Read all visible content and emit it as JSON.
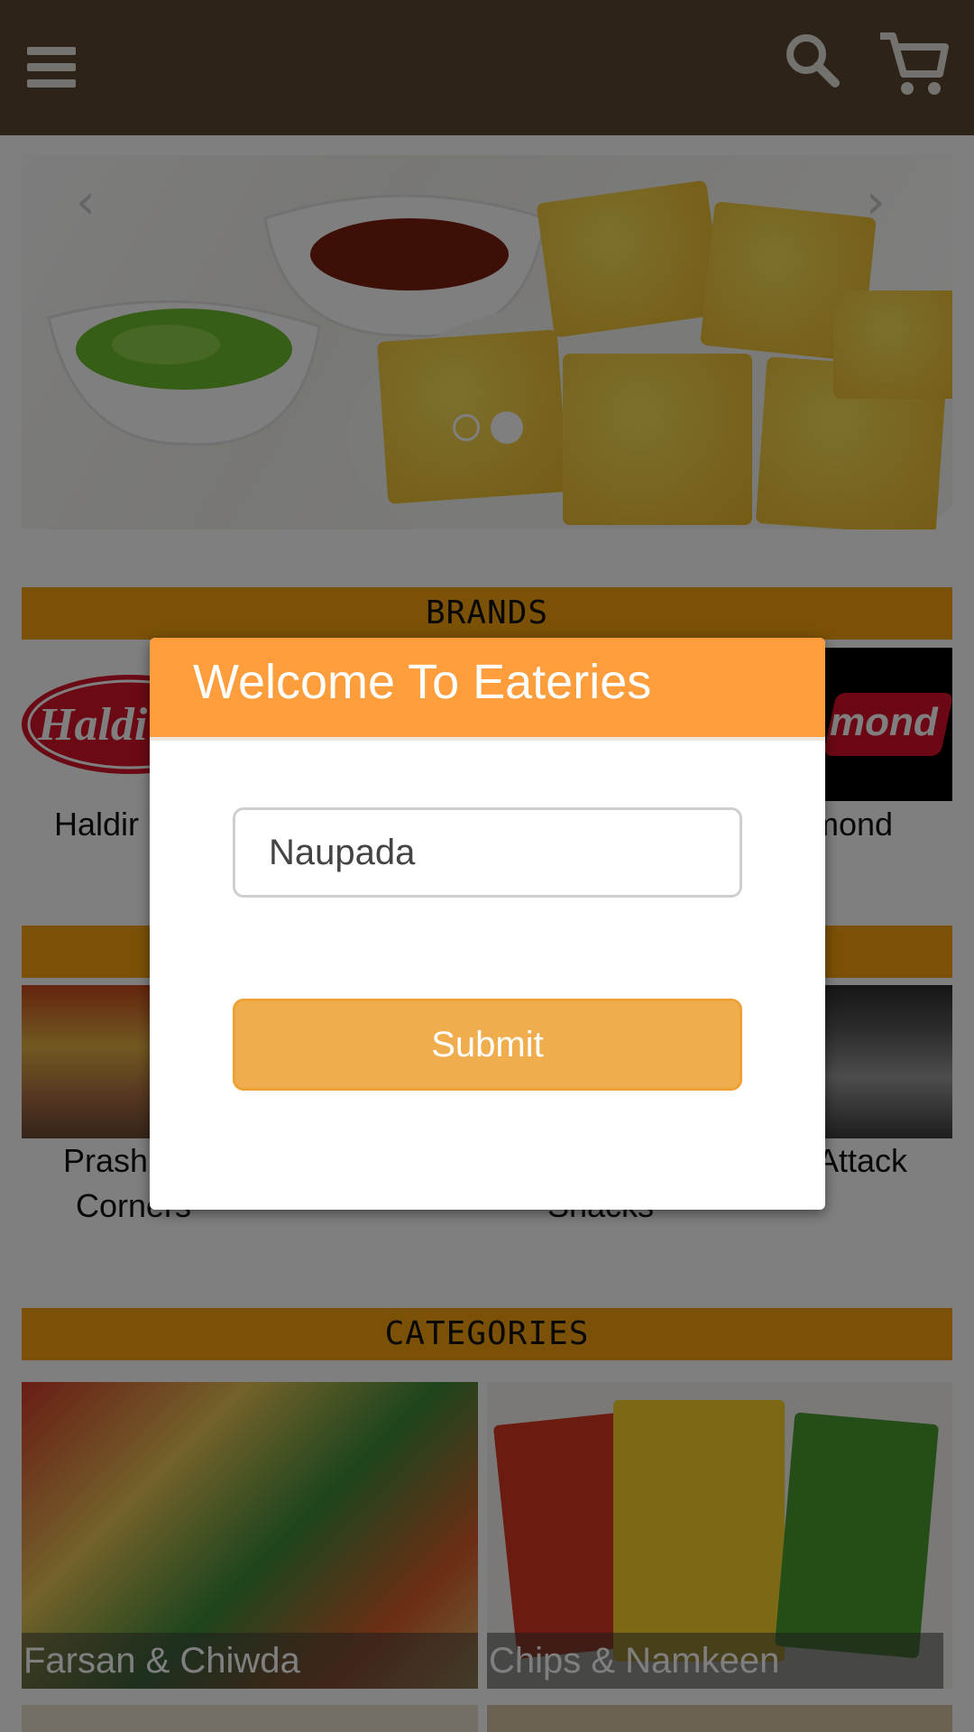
{
  "header": {
    "menu_icon": "hamburger-icon",
    "search_icon": "search-icon",
    "cart_icon": "cart-icon",
    "background": "#5a4630"
  },
  "banner": {
    "prev_icon": "chevron-left-icon",
    "next_icon": "chevron-right-icon",
    "slide_count": 2,
    "active_slide": 2
  },
  "brands": {
    "title": "BRANDS",
    "items": [
      {
        "label": "Haldir",
        "logo_text": "Haldi"
      },
      {
        "label": "mond",
        "logo_text": "mond"
      }
    ]
  },
  "outlets": {
    "items": [
      {
        "label_line1": "Prash",
        "label_line2": "Corners"
      },
      {
        "label_line1": "",
        "label_line2": "Snacks"
      },
      {
        "label_line1": "k Attack",
        "label_line2": ""
      }
    ]
  },
  "categories": {
    "title": "CATEGORIES",
    "items": [
      {
        "label": "Farsan & Chiwda"
      },
      {
        "label": "Chips & Namkeen"
      }
    ]
  },
  "modal": {
    "title": "Welcome To Eateries",
    "location_value": "Naupada",
    "submit_label": "Submit"
  },
  "colors": {
    "accent": "#f7a30e",
    "modal_header": "#fe9d3c",
    "submit": "#f0ad4e"
  }
}
